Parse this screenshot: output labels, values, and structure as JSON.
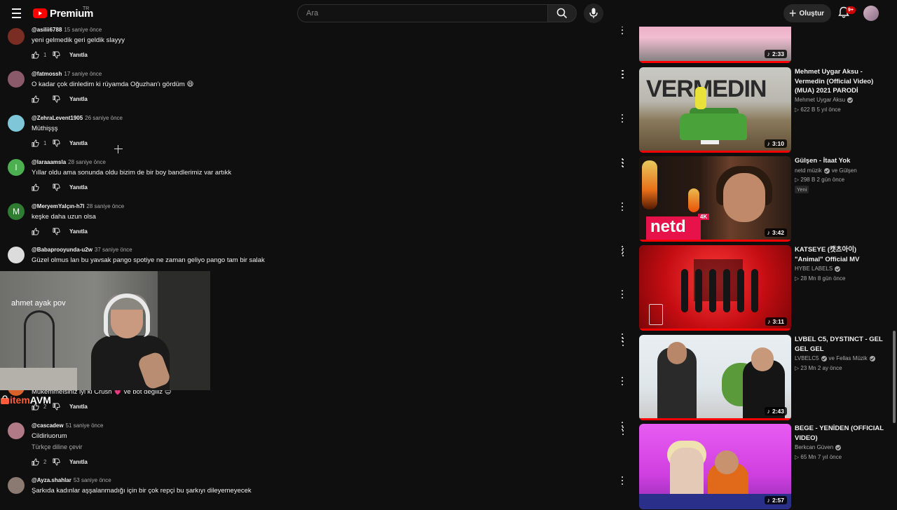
{
  "header": {
    "logo_text": "Premium",
    "region_code": "TR",
    "search_placeholder": "Ara",
    "create_label": "Oluştur",
    "notification_count": "9+"
  },
  "comments": [
    {
      "author": "@asilii6788",
      "time": "15 saniye önce",
      "text": "yeni gelmedik geri geldik slayyy",
      "likes": "1",
      "reply_label": "Yanıtla",
      "avatar_color": "#7a2d22",
      "avatar_letter": ""
    },
    {
      "author": "@fatmossh",
      "time": "17 saniye önce",
      "text": "O kadar çok dinledim ki rüyamda Oğuzhan'ı gördüm 😄",
      "likes": "",
      "reply_label": "Yanıtla",
      "avatar_color": "#8a5a6a",
      "avatar_letter": ""
    },
    {
      "author": "@ZehraLevent1905",
      "time": "26 saniye önce",
      "text": "Müthişşş",
      "likes": "1",
      "reply_label": "Yanıtla",
      "avatar_color": "#7fc6d8",
      "avatar_letter": ""
    },
    {
      "author": "@laraaamsla",
      "time": "28 saniye önce",
      "text": "Yıllar oldu ama sonunda oldu bizim de bir boy bandlerimiz var artıkk",
      "likes": "",
      "reply_label": "Yanıtla",
      "avatar_color": "#4caf50",
      "avatar_letter": "l"
    },
    {
      "author": "@MeryemYalçın-h7l",
      "time": "28 saniye önce",
      "text": "keşke daha uzun olsa",
      "likes": "",
      "reply_label": "Yanıtla",
      "avatar_color": "#2e7d32",
      "avatar_letter": "M"
    },
    {
      "author": "@Babaprooyunda-u2w",
      "time": "37 saniye önce",
      "text": "Güzel olmus lan bu yavsak pango spotiye ne zaman geliyo pango tam bir salak",
      "likes": "",
      "reply_label": "Yanıtla",
      "avatar_color": "#dcdcdc",
      "avatar_letter": ""
    },
    {
      "author": "",
      "time": "",
      "text": "Mükemmelsiniz iyi ki Crush 💗 ve bot değiliz 😇",
      "likes": "2",
      "reply_label": "Yanıtla",
      "avatar_color": "#d9622a",
      "avatar_letter": ""
    },
    {
      "author": "@cascadew",
      "time": "51 saniye önce",
      "text": "Cildiriuorum",
      "translate_label": "Türkçe diline çevir",
      "likes": "2",
      "reply_label": "Yanıtla",
      "avatar_color": "#b07a86",
      "avatar_letter": ""
    },
    {
      "author": "@Ayza.shahlar",
      "time": "53 saniye önce",
      "text": "Şarkıda kadınlar aşşalanmadığı için bir çok repçi bu şarkıyı dileyemeyecek",
      "likes": "",
      "reply_label": "Yanıtla",
      "avatar_color": "#8b7a72",
      "avatar_letter": ""
    }
  ],
  "webcam": {
    "caption": "ahmet ayak pov",
    "brand_part1": "item",
    "brand_part2": "AVM"
  },
  "videos": [
    {
      "title": "",
      "channel": "",
      "stats": "",
      "duration": "2:33",
      "badge": ""
    },
    {
      "title": "Mehmet Uygar Aksu - Vermedin (Official Video) (MUA) 2021 PARODİ",
      "channel": "Mehmet Uygar Aksu",
      "channel_extra": "",
      "stats": "▷ 622 B   5 yıl önce",
      "duration": "3:10",
      "badge": "",
      "thumb_text": "VERMEDIN"
    },
    {
      "title": "Gülşen - İtaat Yok",
      "channel": "netd müzik",
      "channel_extra": "ve Gülşen",
      "stats": "▷ 298 B   2 gün önce",
      "duration": "3:42",
      "badge": "Yeni",
      "thumb_text": "netd",
      "thumb_badge": "4K"
    },
    {
      "title": "KATSEYE (캣츠아이) \"Animal\" Official MV",
      "channel": "HYBE LABELS",
      "channel_extra": "",
      "stats": "▷ 28 Mn   8 gün önce",
      "duration": "3:11",
      "badge": ""
    },
    {
      "title": "LVBEL C5, DYSTINCT - GEL GEL GEL",
      "channel": "LVBELC5",
      "channel_extra": "ve Fellas Müzik",
      "stats": "▷ 23 Mn   2 ay önce",
      "duration": "2:43",
      "badge": ""
    },
    {
      "title": "BEGE - YENİDEN (OFFICIAL VIDEO)",
      "channel": "Berkcan Güven",
      "channel_extra": "",
      "stats": "▷ 65 Mn   7 yıl önce",
      "duration": "2:57",
      "badge": ""
    }
  ],
  "icons": {
    "menu": "menu-icon",
    "search": "search-icon",
    "mic": "mic-icon",
    "create": "plus-icon",
    "bell": "bell-icon",
    "like": "thumb-up-icon",
    "dislike": "thumb-down-icon",
    "more": "more-vertical-icon",
    "music": "music-note-icon",
    "verified": "verified-check-icon"
  },
  "colors": {
    "background": "#0f0f0f",
    "text": "#f1f1f1",
    "secondary_text": "#aaaaaa",
    "brand_red": "#ff0000",
    "badge_red": "#cc0000"
  }
}
